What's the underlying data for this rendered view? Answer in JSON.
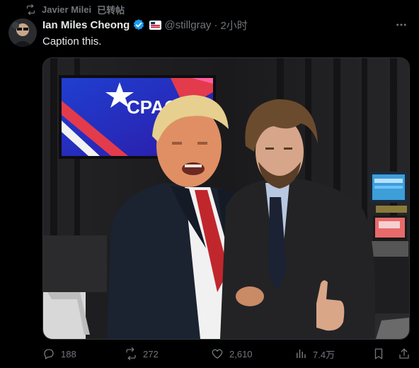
{
  "repost": {
    "user": "Javier Milei",
    "label": "已转帖"
  },
  "author": {
    "name": "Ian Miles Cheong",
    "handle": "@stillgray",
    "separator": "·",
    "time": "2小时"
  },
  "tweet": {
    "text": "Caption this."
  },
  "media": {
    "screen_text": "CPAC"
  },
  "stats": {
    "replies": "188",
    "reposts": "272",
    "likes": "2,610",
    "views": "7.4万"
  },
  "colors": {
    "verified": "#1d9bf0",
    "muted": "#71767b",
    "text": "#e7e9ea",
    "background": "#000000"
  },
  "icons": [
    "repost-icon",
    "verified-icon",
    "affiliate-badge-icon",
    "more-icon",
    "reply-icon",
    "like-icon",
    "views-icon",
    "bookmark-icon",
    "share-icon"
  ]
}
